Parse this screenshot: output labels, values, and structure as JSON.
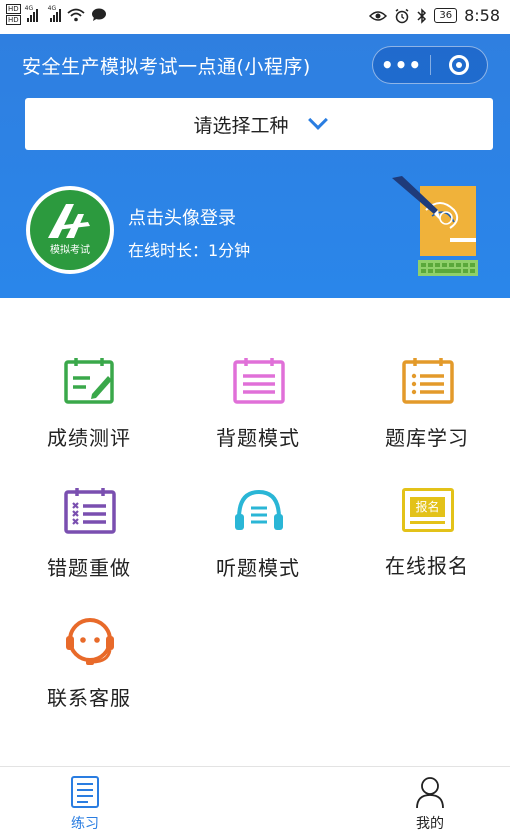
{
  "status_bar": {
    "hd1": "HD",
    "hd2": "HD",
    "net1": "4G",
    "net2": "4G",
    "battery": "36",
    "time": "8:58"
  },
  "header": {
    "title": "安全生产模拟考试一点通(小程序)",
    "more_icon": "more-dots-icon",
    "close_icon": "target-icon",
    "select_label": "请选择工种",
    "avatar_text": "模拟考试",
    "login_prompt": "点击头像登录",
    "online_duration": "在线时长：1分钟"
  },
  "menu": {
    "items": [
      {
        "label": "成绩测评",
        "icon": "score-edit-icon",
        "color": "#3aa84a"
      },
      {
        "label": "背题模式",
        "icon": "notebook-icon",
        "color": "#e070d8"
      },
      {
        "label": "题库学习",
        "icon": "question-bank-icon",
        "color": "#e39a2a"
      },
      {
        "label": "错题重做",
        "icon": "wrong-list-icon",
        "color": "#7a4fb0"
      },
      {
        "label": "听题模式",
        "icon": "headphones-icon",
        "color": "#2ab6d6"
      },
      {
        "label": "在线报名",
        "icon": "signup-badge-icon",
        "color": "#e3c219"
      },
      {
        "label": "联系客服",
        "icon": "support-headset-icon",
        "color": "#e86a2a"
      }
    ],
    "signup_badge_text": "报名"
  },
  "tabbar": {
    "tabs": [
      {
        "label": "练习",
        "icon": "practice-icon",
        "color": "#2a7de1"
      },
      {
        "label": "我的",
        "icon": "user-icon",
        "color": "#222222"
      }
    ]
  }
}
